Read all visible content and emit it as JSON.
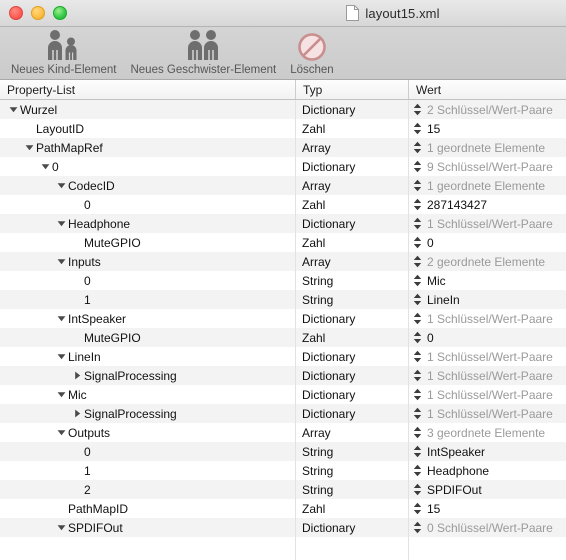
{
  "window": {
    "document_title": "layout15.xml",
    "traffic_lights": [
      "close-button",
      "minimize-button",
      "zoom-button"
    ],
    "colors": {
      "red": "#fc5d56",
      "yellow": "#fdbc40",
      "green": "#34c749",
      "row_alt": "#f3f3f4",
      "toolbar": "#cfcfcf",
      "value_gray": "#9a9a9a"
    }
  },
  "toolbar": {
    "buttons": [
      {
        "label": "Neues Kind-Element",
        "icon": "two-people-icon"
      },
      {
        "label": "Neues Geschwister-Element",
        "icon": "two-people-icon"
      },
      {
        "label": "Löschen",
        "icon": "no-entry-icon"
      }
    ]
  },
  "table": {
    "columns": [
      {
        "label": "Property-List"
      },
      {
        "label": "Typ"
      },
      {
        "label": "Wert"
      }
    ],
    "rows": [
      {
        "key": "Wurzel",
        "indent": 0,
        "twisty": "down",
        "typ": "Dictionary",
        "wert": "2 Schlüssel/Wert-Paare",
        "value_style": "gray"
      },
      {
        "key": "LayoutID",
        "indent": 1,
        "twisty": "none",
        "typ": "Zahl",
        "wert": "15",
        "value_style": "dark"
      },
      {
        "key": "PathMapRef",
        "indent": 1,
        "twisty": "down",
        "typ": "Array",
        "wert": "1 geordnete Elemente",
        "value_style": "gray"
      },
      {
        "key": "0",
        "indent": 2,
        "twisty": "down",
        "typ": "Dictionary",
        "wert": "9 Schlüssel/Wert-Paare",
        "value_style": "gray"
      },
      {
        "key": "CodecID",
        "indent": 3,
        "twisty": "down",
        "typ": "Array",
        "wert": "1 geordnete Elemente",
        "value_style": "gray"
      },
      {
        "key": "0",
        "indent": 4,
        "twisty": "none",
        "typ": "Zahl",
        "wert": "287143427",
        "value_style": "dark"
      },
      {
        "key": "Headphone",
        "indent": 3,
        "twisty": "down",
        "typ": "Dictionary",
        "wert": "1 Schlüssel/Wert-Paare",
        "value_style": "gray"
      },
      {
        "key": "MuteGPIO",
        "indent": 4,
        "twisty": "none",
        "typ": "Zahl",
        "wert": "0",
        "value_style": "dark"
      },
      {
        "key": "Inputs",
        "indent": 3,
        "twisty": "down",
        "typ": "Array",
        "wert": "2 geordnete Elemente",
        "value_style": "gray"
      },
      {
        "key": "0",
        "indent": 4,
        "twisty": "none",
        "typ": "String",
        "wert": "Mic",
        "value_style": "dark"
      },
      {
        "key": "1",
        "indent": 4,
        "twisty": "none",
        "typ": "String",
        "wert": "LineIn",
        "value_style": "dark"
      },
      {
        "key": "IntSpeaker",
        "indent": 3,
        "twisty": "down",
        "typ": "Dictionary",
        "wert": "1 Schlüssel/Wert-Paare",
        "value_style": "gray"
      },
      {
        "key": "MuteGPIO",
        "indent": 4,
        "twisty": "none",
        "typ": "Zahl",
        "wert": "0",
        "value_style": "dark"
      },
      {
        "key": "LineIn",
        "indent": 3,
        "twisty": "down",
        "typ": "Dictionary",
        "wert": "1 Schlüssel/Wert-Paare",
        "value_style": "gray"
      },
      {
        "key": "SignalProcessing",
        "indent": 4,
        "twisty": "right",
        "typ": "Dictionary",
        "wert": "1 Schlüssel/Wert-Paare",
        "value_style": "gray"
      },
      {
        "key": "Mic",
        "indent": 3,
        "twisty": "down",
        "typ": "Dictionary",
        "wert": "1 Schlüssel/Wert-Paare",
        "value_style": "gray"
      },
      {
        "key": "SignalProcessing",
        "indent": 4,
        "twisty": "right",
        "typ": "Dictionary",
        "wert": "1 Schlüssel/Wert-Paare",
        "value_style": "gray"
      },
      {
        "key": "Outputs",
        "indent": 3,
        "twisty": "down",
        "typ": "Array",
        "wert": "3 geordnete Elemente",
        "value_style": "gray"
      },
      {
        "key": "0",
        "indent": 4,
        "twisty": "none",
        "typ": "String",
        "wert": "IntSpeaker",
        "value_style": "dark"
      },
      {
        "key": "1",
        "indent": 4,
        "twisty": "none",
        "typ": "String",
        "wert": "Headphone",
        "value_style": "dark"
      },
      {
        "key": "2",
        "indent": 4,
        "twisty": "none",
        "typ": "String",
        "wert": "SPDIFOut",
        "value_style": "dark"
      },
      {
        "key": "PathMapID",
        "indent": 3,
        "twisty": "none",
        "typ": "Zahl",
        "wert": "15",
        "value_style": "dark"
      },
      {
        "key": "SPDIFOut",
        "indent": 3,
        "twisty": "down",
        "typ": "Dictionary",
        "wert": "0 Schlüssel/Wert-Paare",
        "value_style": "gray"
      }
    ]
  }
}
